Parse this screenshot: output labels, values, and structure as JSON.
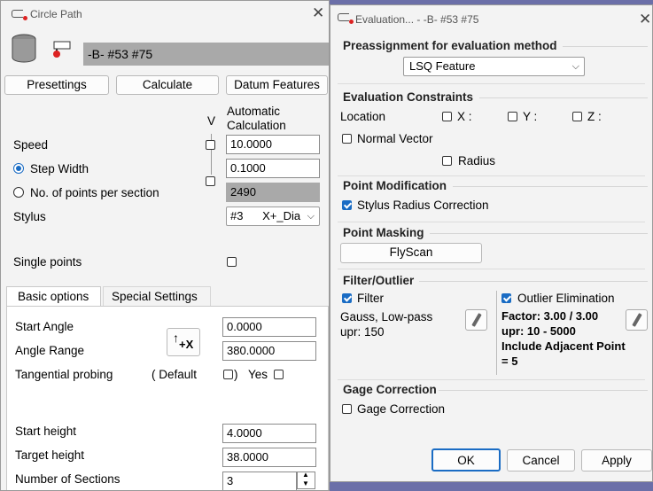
{
  "left_window": {
    "title": "Circle Path",
    "element_name": "-B- #53 #75",
    "buttons": {
      "presettings": "Presettings",
      "calculate": "Calculate",
      "datum_features": "Datum Features"
    },
    "v_label": "V",
    "auto_calc_label": "Automatic Calculation",
    "speed": {
      "label": "Speed",
      "value": "10.0000"
    },
    "step_width": {
      "label": "Step Width",
      "value": "0.1000"
    },
    "points_per_section": {
      "label": "No. of points per section",
      "value": "2490"
    },
    "stylus": {
      "label": "Stylus",
      "value": "#3      X+_Dia"
    },
    "single_points_label": "Single points",
    "tabs": {
      "basic": "Basic options",
      "special": "Special Settings"
    },
    "start_angle": {
      "label": "Start Angle",
      "value": "0.0000"
    },
    "angle_range": {
      "label": "Angle Range",
      "value": "380.0000"
    },
    "direction_btn": "+X",
    "tangential": {
      "label": "Tangential probing",
      "default_open": "( Default",
      "close_paren": ")",
      "yes": "Yes"
    },
    "start_height": {
      "label": "Start height",
      "value": "4.0000"
    },
    "target_height": {
      "label": "Target height",
      "value": "38.0000"
    },
    "num_sections": {
      "label": "Number of Sections",
      "value": "3"
    }
  },
  "right_window": {
    "title": "Evaluation... - -B- #53 #75",
    "preassignment": {
      "title": "Preassignment for evaluation method",
      "method": "LSQ Feature"
    },
    "constraints": {
      "title": "Evaluation Constraints",
      "location": "Location",
      "x": "X :",
      "y": "Y :",
      "z": "Z :",
      "normal_vector": "Normal Vector",
      "radius": "Radius"
    },
    "point_modification": {
      "title": "Point Modification",
      "stylus_radius_correction": "Stylus Radius Correction"
    },
    "point_masking": {
      "title": "Point Masking",
      "flyscan": "FlyScan"
    },
    "filter_outlier": {
      "title": "Filter/Outlier",
      "filter_label": "Filter",
      "filter_desc1": "Gauss, Low-pass",
      "filter_desc2": "upr: 150",
      "outlier_label": "Outlier Elimination",
      "outlier_l1": "Factor: 3.00 / 3.00",
      "outlier_l2": "upr: 10 - 5000",
      "outlier_l3": "Include Adjacent Points, n",
      "outlier_l4": "= 5"
    },
    "gage_correction": {
      "title": "Gage Correction",
      "label": "Gage Correction"
    },
    "buttons": {
      "ok": "OK",
      "cancel": "Cancel",
      "apply": "Apply"
    }
  }
}
